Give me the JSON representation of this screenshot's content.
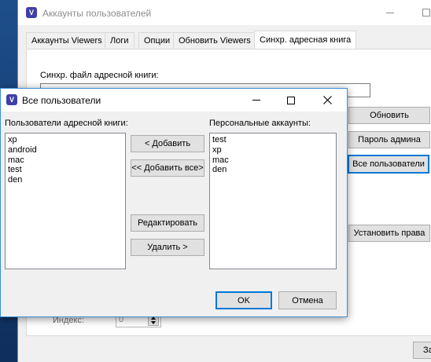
{
  "main_window": {
    "title": "Аккаунты пользователей",
    "tabs": [
      {
        "label": "Аккаунты Viewers"
      },
      {
        "label": "Логи"
      },
      {
        "label": "Опции"
      },
      {
        "label": "Обновить Viewers"
      },
      {
        "label": "Синхр. адресная книга"
      }
    ],
    "sync_file_label": "Синхр. файл адресной книги:",
    "buttons": {
      "update": "Обновить",
      "admin_password": "Пароль админа",
      "all_users": "Все пользователи",
      "set_rights": "Установить права",
      "bottom_cut": "За"
    },
    "index_label": "Индекс:",
    "index_value": "0"
  },
  "dialog": {
    "title": "Все пользователи",
    "left_label": "Пользователи адресной книги:",
    "left_items": [
      "xp",
      "android",
      "mac",
      "test",
      "den"
    ],
    "right_label": "Персональные аккаунты:",
    "right_items": [
      "test",
      "xp",
      "mac",
      "den"
    ],
    "buttons": {
      "add": "< Добавить",
      "add_all": "<< Добавить все>",
      "edit": "Редактировать",
      "remove": "Удалить >",
      "ok": "OK",
      "cancel": "Отмена"
    }
  }
}
